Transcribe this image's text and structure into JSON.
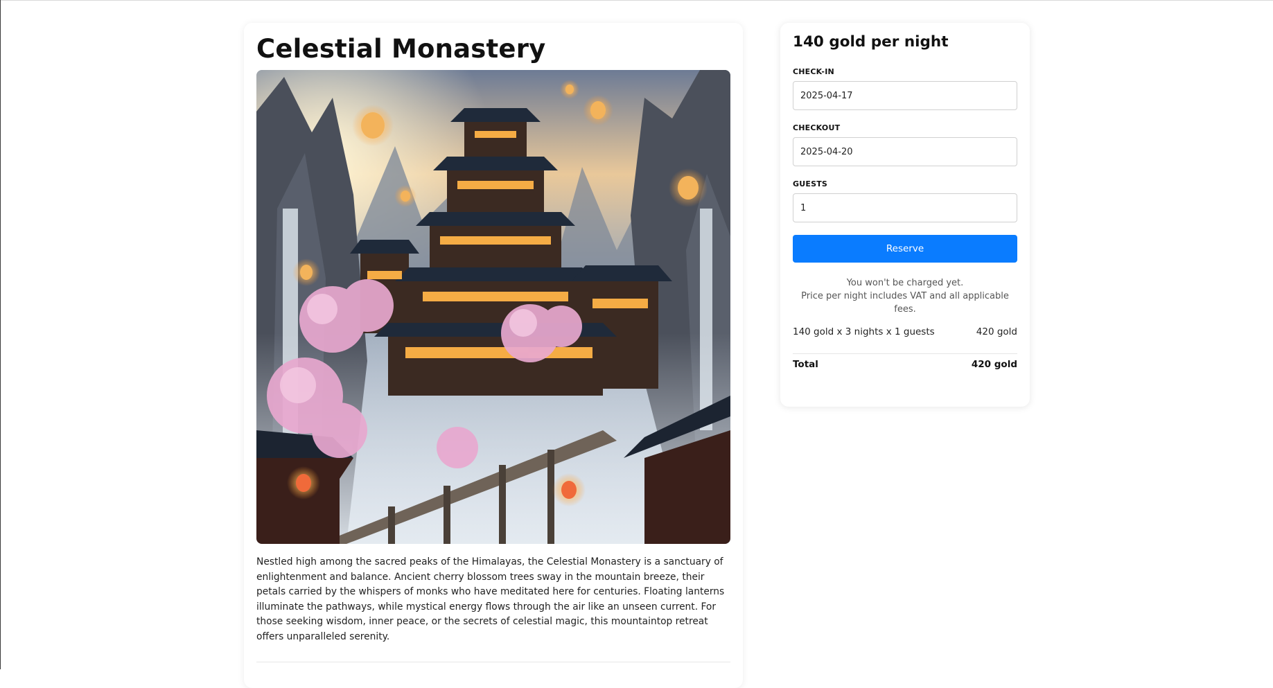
{
  "listing": {
    "title": "Celestial Monastery",
    "image_alt": "Celestial Monastery",
    "description": "Nestled high among the sacred peaks of the Himalayas, the Celestial Monastery is a sanctuary of enlightenment and balance. Ancient cherry blossom trees sway in the mountain breeze, their petals carried by the whispers of monks who have meditated here for centuries. Floating lanterns illuminate the pathways, while mystical energy flows through the air like an unseen current. For those seeking wisdom, inner peace, or the secrets of celestial magic, this mountaintop retreat offers unparalleled serenity."
  },
  "booking": {
    "price_heading": "140 gold per night",
    "checkin": {
      "label": "CHECK-IN",
      "value": "2025-04-17"
    },
    "checkout": {
      "label": "CHECKOUT",
      "value": "2025-04-20"
    },
    "guests": {
      "label": "GUESTS",
      "value": "1"
    },
    "reserve_label": "Reserve",
    "note_line1": "You won't be charged yet.",
    "note_line2": "Price per night includes VAT and all applicable fees.",
    "breakdown_label": "140 gold x 3 nights x 1 guests",
    "breakdown_amount": "420 gold",
    "total_label": "Total",
    "total_amount": "420 gold",
    "accent_color": "#0a7cff"
  }
}
